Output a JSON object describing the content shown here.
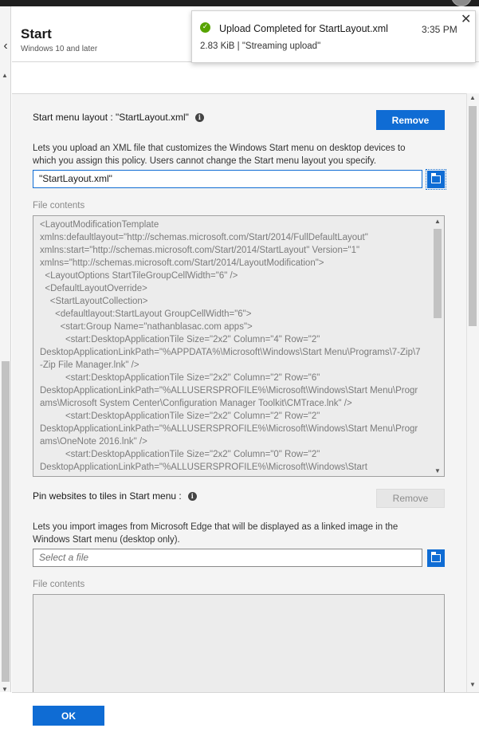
{
  "header": {
    "title": "Start",
    "subtitle": "Windows 10 and later"
  },
  "notification": {
    "title": "Upload Completed for StartLayout.xml",
    "time": "3:35 PM",
    "detail": "2.83 KiB | \"Streaming upload\""
  },
  "start_layout": {
    "label": "Start menu layout : \"StartLayout.xml\"",
    "remove_label": "Remove",
    "description": "Lets you upload an XML file that customizes the Windows Start menu on desktop devices to which you assign this policy. Users cannot change the Start menu layout you specify.",
    "file_value": "\"StartLayout.xml\"",
    "file_contents_label": "File contents",
    "file_contents": "<LayoutModificationTemplate\nxmlns:defaultlayout=\"http://schemas.microsoft.com/Start/2014/FullDefaultLayout\"\nxmlns:start=\"http://schemas.microsoft.com/Start/2014/StartLayout\" Version=\"1\"\nxmlns=\"http://schemas.microsoft.com/Start/2014/LayoutModification\">\n  <LayoutOptions StartTileGroupCellWidth=\"6\" />\n  <DefaultLayoutOverride>\n    <StartLayoutCollection>\n      <defaultlayout:StartLayout GroupCellWidth=\"6\">\n        <start:Group Name=\"nathanblasac.com apps\">\n          <start:DesktopApplicationTile Size=\"2x2\" Column=\"4\" Row=\"2\"\nDesktopApplicationLinkPath=\"%APPDATA%\\Microsoft\\Windows\\Start Menu\\Programs\\7-Zip\\7-Zip File Manager.lnk\" />\n          <start:DesktopApplicationTile Size=\"2x2\" Column=\"2\" Row=\"6\"\nDesktopApplicationLinkPath=\"%ALLUSERSPROFILE%\\Microsoft\\Windows\\Start Menu\\Programs\\Microsoft System Center\\Configuration Manager Toolkit\\CMTrace.lnk\" />\n          <start:DesktopApplicationTile Size=\"2x2\" Column=\"2\" Row=\"2\"\nDesktopApplicationLinkPath=\"%ALLUSERSPROFILE%\\Microsoft\\Windows\\Start Menu\\Programs\\OneNote 2016.lnk\" />\n          <start:DesktopApplicationTile Size=\"2x2\" Column=\"0\" Row=\"2\"\nDesktopApplicationLinkPath=\"%ALLUSERSPROFILE%\\Microsoft\\Windows\\Start"
  },
  "pin_websites": {
    "label": "Pin websites to tiles in Start menu :",
    "remove_label": "Remove",
    "description": "Lets you import images from Microsoft Edge that will be displayed as a linked image in the Windows Start menu (desktop only).",
    "file_placeholder": "Select a file",
    "file_contents_label": "File contents",
    "file_contents": ""
  },
  "footer": {
    "ok_label": "OK"
  }
}
